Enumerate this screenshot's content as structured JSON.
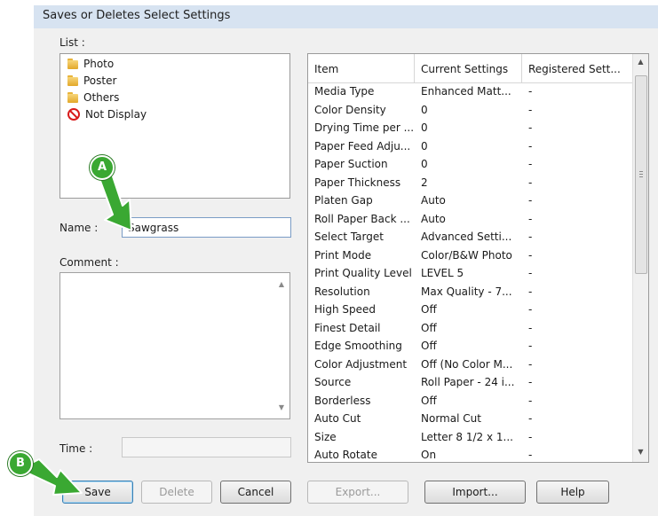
{
  "window": {
    "title": "Saves or Deletes Select Settings"
  },
  "list": {
    "label": "List :",
    "items": [
      {
        "label": "Photo",
        "icon": "folder-icon"
      },
      {
        "label": "Poster",
        "icon": "folder-icon"
      },
      {
        "label": "Others",
        "icon": "folder-icon"
      },
      {
        "label": "Not Display",
        "icon": "no-entry-icon"
      }
    ]
  },
  "name": {
    "label": "Name :",
    "value": "Sawgrass"
  },
  "comment": {
    "label": "Comment :"
  },
  "time": {
    "label": "Time :"
  },
  "settings_table": {
    "columns": [
      "Item",
      "Current Settings",
      "Registered Sett..."
    ],
    "rows": [
      [
        "Media Type",
        "Enhanced Matt...",
        "-"
      ],
      [
        "Color Density",
        "0",
        "-"
      ],
      [
        "Drying Time per ...",
        "0",
        "-"
      ],
      [
        "Paper Feed Adju...",
        "0",
        "-"
      ],
      [
        "Paper Suction",
        "0",
        "-"
      ],
      [
        "Paper Thickness",
        "2",
        "-"
      ],
      [
        "Platen Gap",
        "Auto",
        "-"
      ],
      [
        "Roll Paper Back ...",
        "Auto",
        "-"
      ],
      [
        "Select Target",
        "Advanced Setti...",
        "-"
      ],
      [
        "Print Mode",
        "Color/B&W Photo",
        "-"
      ],
      [
        "Print Quality Level",
        "LEVEL 5",
        "-"
      ],
      [
        "Resolution",
        "Max Quality - 7...",
        "-"
      ],
      [
        "High Speed",
        "Off",
        "-"
      ],
      [
        "Finest Detail",
        "Off",
        "-"
      ],
      [
        "Edge Smoothing",
        "Off",
        "-"
      ],
      [
        "Color Adjustment",
        "Off (No Color M...",
        "-"
      ],
      [
        "Source",
        "Roll Paper - 24 i...",
        "-"
      ],
      [
        "Borderless",
        "Off",
        "-"
      ],
      [
        "Auto Cut",
        "Normal Cut",
        "-"
      ],
      [
        "Size",
        "Letter 8 1/2 x 1...",
        "-"
      ],
      [
        "Auto Rotate",
        "On",
        "-"
      ]
    ]
  },
  "buttons": {
    "save": "Save",
    "delete": "Delete",
    "cancel": "Cancel",
    "export": "Export...",
    "import": "Import...",
    "help": "Help"
  },
  "callouts": {
    "a": "A",
    "b": "B"
  },
  "colors": {
    "callout_green": "#3aa832",
    "titlebar": "#d7e3f1",
    "dialog_bg": "#f0f0f0"
  }
}
